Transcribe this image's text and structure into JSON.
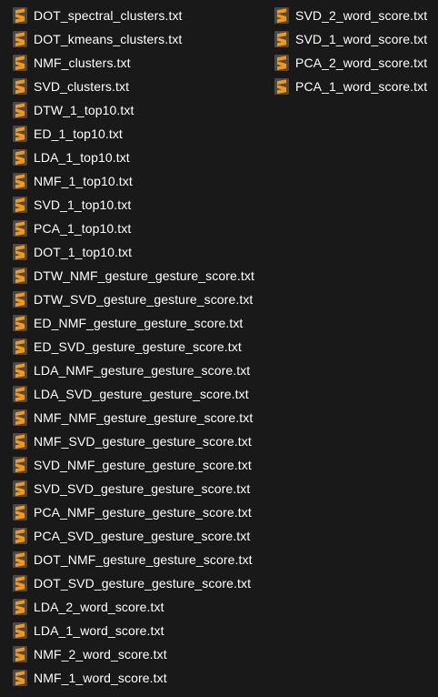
{
  "colors": {
    "background": "#191919",
    "text": "#ffffff",
    "icon_background": "#4a4a4a",
    "icon_accent": "#ff9800"
  },
  "icon": "sublime-text-file-icon",
  "columns": [
    {
      "files": [
        "DOT_spectral_clusters.txt",
        "DOT_kmeans_clusters.txt",
        "NMF_clusters.txt",
        "SVD_clusters.txt",
        "DTW_1_top10.txt",
        "ED_1_top10.txt",
        "LDA_1_top10.txt",
        "NMF_1_top10.txt",
        "SVD_1_top10.txt",
        "PCA_1_top10.txt",
        "DOT_1_top10.txt",
        "DTW_NMF_gesture_gesture_score.txt",
        "DTW_SVD_gesture_gesture_score.txt",
        "ED_NMF_gesture_gesture_score.txt",
        "ED_SVD_gesture_gesture_score.txt",
        "LDA_NMF_gesture_gesture_score.txt",
        "LDA_SVD_gesture_gesture_score.txt",
        "NMF_NMF_gesture_gesture_score.txt",
        "NMF_SVD_gesture_gesture_score.txt",
        "SVD_NMF_gesture_gesture_score.txt",
        "SVD_SVD_gesture_gesture_score.txt",
        "PCA_NMF_gesture_gesture_score.txt",
        "PCA_SVD_gesture_gesture_score.txt",
        "DOT_NMF_gesture_gesture_score.txt",
        "DOT_SVD_gesture_gesture_score.txt",
        "LDA_2_word_score.txt",
        "LDA_1_word_score.txt",
        "NMF_2_word_score.txt",
        "NMF_1_word_score.txt"
      ]
    },
    {
      "files": [
        "SVD_2_word_score.txt",
        "SVD_1_word_score.txt",
        "PCA_2_word_score.txt",
        "PCA_1_word_score.txt"
      ]
    }
  ]
}
